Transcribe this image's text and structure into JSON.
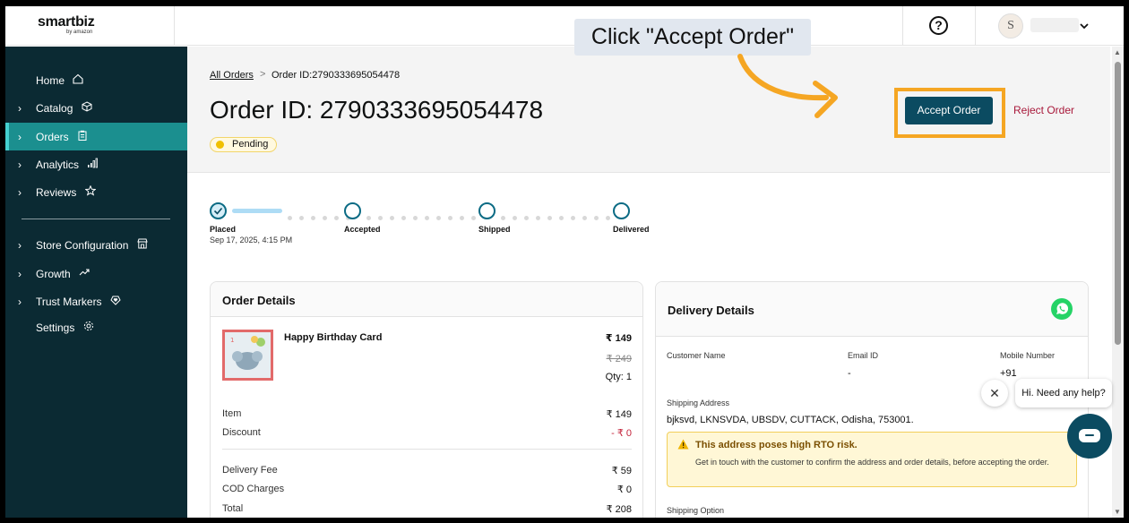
{
  "header": {
    "logo_text": "smartbiz",
    "logo_sub": "by amazon",
    "help_symbol": "?",
    "avatar_initial": "S"
  },
  "sidebar": {
    "items": [
      {
        "label": "Home",
        "icon": "home-icon",
        "has_arrow": false
      },
      {
        "label": "Catalog",
        "icon": "box-icon",
        "has_arrow": true
      },
      {
        "label": "Orders",
        "icon": "clipboard-icon",
        "has_arrow": true,
        "active": true
      },
      {
        "label": "Analytics",
        "icon": "bar-chart-icon",
        "has_arrow": true
      },
      {
        "label": "Reviews",
        "icon": "star-icon",
        "has_arrow": true
      },
      {
        "label": "Store Configuration",
        "icon": "store-icon",
        "has_arrow": true
      },
      {
        "label": "Growth",
        "icon": "trend-up-icon",
        "has_arrow": true
      },
      {
        "label": "Trust Markers",
        "icon": "shield-heart-icon",
        "has_arrow": true
      },
      {
        "label": "Settings",
        "icon": "gear-icon",
        "has_arrow": false
      }
    ]
  },
  "breadcrumb": {
    "link": "All Orders",
    "separator": ">",
    "current": "Order ID:2790333695054478"
  },
  "order": {
    "title": "Order ID: 2790333695054478",
    "status": "Pending",
    "accept_label": "Accept Order",
    "reject_label": "Reject Order"
  },
  "progress": {
    "steps": [
      {
        "label": "Placed",
        "date": "Sep 17, 2025, 4:15 PM",
        "done": true
      },
      {
        "label": "Accepted",
        "done": false
      },
      {
        "label": "Shipped",
        "done": false
      },
      {
        "label": "Delivered",
        "done": false
      }
    ]
  },
  "order_details": {
    "title": "Order Details",
    "product_name": "Happy Birthday Card",
    "price": "₹ 149",
    "mrp": "₹ 249",
    "qty": "Qty: 1",
    "item_label": "Item",
    "item_value": "₹ 149",
    "discount_label": "Discount",
    "discount_value": "- ₹ 0",
    "delivery_label": "Delivery Fee",
    "delivery_value": "₹ 59",
    "cod_label": "COD Charges",
    "cod_value": "₹ 0",
    "total_label": "Total",
    "total_value": "₹ 208"
  },
  "delivery_details": {
    "title": "Delivery Details",
    "customer_name_label": "Customer Name",
    "email_label": "Email ID",
    "email_value": "-",
    "mobile_label": "Mobile Number",
    "mobile_value": "+91 ",
    "shipping_address_label": "Shipping Address",
    "shipping_address": "bjksvd, LKNSVDA, UBSDV, CUTTACK, Odisha, 753001.",
    "warning_title": "This address poses high RTO risk.",
    "warning_text": "Get in touch with the customer to confirm the address and order details, before accepting the order.",
    "shipping_option_label": "Shipping Option"
  },
  "chat": {
    "bubble_text": "Hi. Need any help?",
    "close_symbol": "✕"
  },
  "annotation": {
    "callout_text": "Click \"Accept Order\""
  },
  "colors": {
    "sidebar_bg": "#0b2a33",
    "sidebar_active": "#1b8f8f",
    "primary_button": "#0b4b61",
    "reject_text": "#a8183a",
    "highlight": "#f5a623",
    "warning_bg": "#fff7d6"
  }
}
